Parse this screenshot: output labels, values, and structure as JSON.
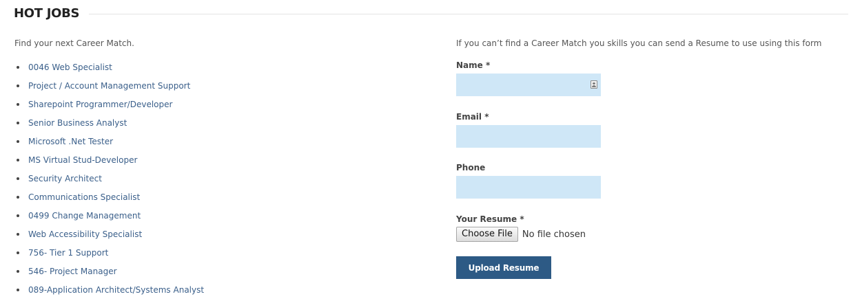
{
  "section": {
    "title": "HOT JOBS"
  },
  "left": {
    "intro": "Find your next Career Match.",
    "jobs": [
      "0046 Web Specialist",
      "Project / Account Management Support",
      "Sharepoint Programmer/Developer",
      "Senior Business Analyst",
      "Microsoft .Net Tester",
      "MS Virtual Stud-Developer",
      "Security Architect",
      "Communications Specialist",
      "0499 Change Management",
      "Web Accessibility Specialist",
      "756- Tier 1 Support",
      "546- Project Manager",
      "089-Application Architect/Systems Analyst"
    ]
  },
  "form": {
    "intro": "If you can’t find a Career Match you skills you can send a Resume to use using this form",
    "name": {
      "label": "Name *",
      "value": "",
      "icon": "contact-card-icon"
    },
    "email": {
      "label": "Email *",
      "value": ""
    },
    "phone": {
      "label": "Phone",
      "value": ""
    },
    "resume": {
      "label": "Your Resume *",
      "button_label": "Choose File",
      "status": "No file chosen"
    },
    "submit_label": "Upload Resume"
  },
  "colors": {
    "input_background": "#cfe7f7",
    "link": "#3a5f8a",
    "button_background": "#2d5a85",
    "rule": "#e4e4e4"
  }
}
